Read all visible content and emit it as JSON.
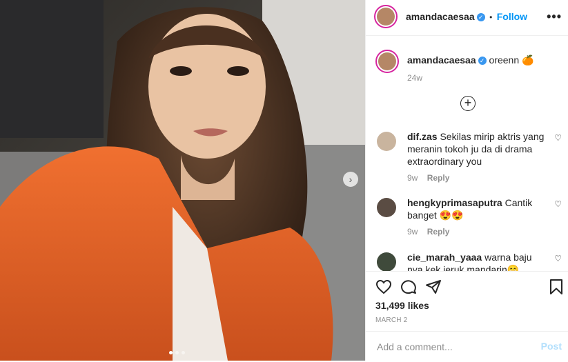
{
  "post": {
    "owner": "amandacaesaa",
    "follow_label": "Follow",
    "separator": "•",
    "more_label": "•••",
    "caption": "oreenn 🍊",
    "caption_age": "24w",
    "load_more_label": "+",
    "likes": "31,499 likes",
    "date": "MARCH 2",
    "carousel_total": 3,
    "carousel_active": 1
  },
  "comments": [
    {
      "user": "dif.zas",
      "text": "Sekilas mirip aktris yang meranin tokoh ju da di drama extraordinary you",
      "age": "9w",
      "reply": "Reply"
    },
    {
      "user": "hengkyprimasaputra",
      "text": "Cantik banget 😍😍",
      "age": "9w",
      "reply": "Reply"
    },
    {
      "user": "cie_marah_yaaa",
      "text": "warna baju nya kek jeruk mandarin😁",
      "age": "",
      "reply": ""
    }
  ],
  "composer": {
    "placeholder": "Add a comment...",
    "post_label": "Post"
  },
  "icons": {
    "like": "heart-icon",
    "comment": "comment-icon",
    "share": "paper-plane-icon",
    "save": "bookmark-icon"
  },
  "colors": {
    "accent": "#0095f6",
    "verified": "#3897f0",
    "sweater": "#e8622a"
  }
}
